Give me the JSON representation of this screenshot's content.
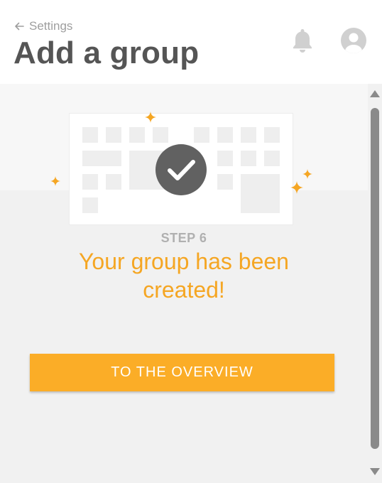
{
  "header": {
    "back_label": "Settings",
    "title": "Add a group"
  },
  "icons": {
    "back": "arrow-left-icon",
    "notifications": "bell-icon",
    "account": "user-avatar-icon",
    "success": "checkmark-icon",
    "decoration": "sparkle-icon"
  },
  "main": {
    "step_label": "STEP 6",
    "message": "Your group has been created!",
    "cta_label": "TO THE OVERVIEW"
  },
  "colors": {
    "accent": "#fbad27",
    "message": "#f5a623",
    "title": "#555555",
    "badge": "#616161",
    "muted": "#b0b0b0"
  }
}
